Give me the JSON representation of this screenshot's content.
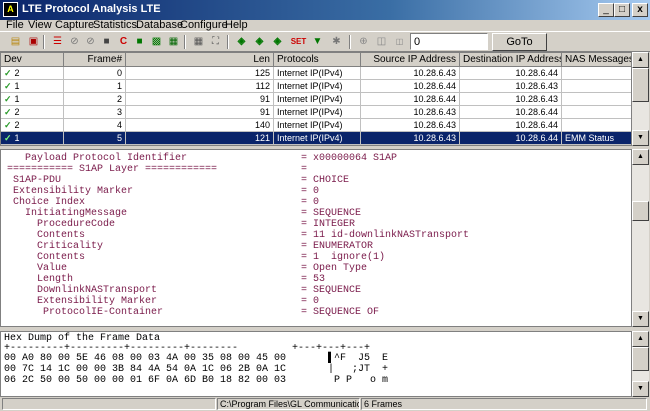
{
  "window": {
    "title": "LTE Protocol Analysis LTE",
    "icon_text": "A",
    "controls": [
      "_",
      "□",
      "x"
    ]
  },
  "menu": [
    "File",
    "View",
    "Capture",
    "Statistics",
    "Database",
    "Configure",
    "Help"
  ],
  "toolbar": {
    "goto_value": "0",
    "goto_label": "GoTo",
    "set_label": "SET"
  },
  "grid": {
    "columns": [
      "Dev",
      "Frame#",
      "Len",
      "Protocols",
      "Source IP Address",
      "Destination IP Address",
      "NAS Messages"
    ],
    "rows": [
      {
        "dev": "2",
        "frame": "0",
        "len": "125",
        "protocol": "Internet IP(IPv4)",
        "src": "10.28.6.43",
        "dst": "10.28.6.44",
        "nas": ""
      },
      {
        "dev": "1",
        "frame": "1",
        "len": "112",
        "protocol": "Internet IP(IPv4)",
        "src": "10.28.6.44",
        "dst": "10.28.6.43",
        "nas": ""
      },
      {
        "dev": "1",
        "frame": "2",
        "len": "91",
        "protocol": "Internet IP(IPv4)",
        "src": "10.28.6.44",
        "dst": "10.28.6.43",
        "nas": ""
      },
      {
        "dev": "2",
        "frame": "3",
        "len": "91",
        "protocol": "Internet IP(IPv4)",
        "src": "10.28.6.43",
        "dst": "10.28.6.44",
        "nas": ""
      },
      {
        "dev": "2",
        "frame": "4",
        "len": "140",
        "protocol": "Internet IP(IPv4)",
        "src": "10.28.6.43",
        "dst": "10.28.6.44",
        "nas": ""
      },
      {
        "dev": "1",
        "frame": "5",
        "len": "121",
        "protocol": "Internet IP(IPv4)",
        "src": "10.28.6.43",
        "dst": "10.28.6.44",
        "nas": "EMM Status"
      }
    ]
  },
  "decode": [
    {
      "name": "    Payload Protocol Identifier",
      "value": "= x00000064 S1AP"
    },
    {
      "name": " =========== S1AP Layer ============",
      "value": "="
    },
    {
      "name": "  S1AP-PDU",
      "value": "= CHOICE"
    },
    {
      "name": "  Extensibility Marker",
      "value": "= 0"
    },
    {
      "name": "  Choice Index",
      "value": "= 0"
    },
    {
      "name": "    InitiatingMessage",
      "value": "= SEQUENCE"
    },
    {
      "name": "      ProcedureCode",
      "value": "= INTEGER"
    },
    {
      "name": "      Contents",
      "value": "= 11 id-downlinkNASTransport"
    },
    {
      "name": "      Criticality",
      "value": "= ENUMERATOR"
    },
    {
      "name": "      Contents",
      "value": "= 1  ignore(1)"
    },
    {
      "name": "      Value",
      "value": "= Open Type"
    },
    {
      "name": "      Length",
      "value": "= 53"
    },
    {
      "name": "      DownlinkNASTransport",
      "value": "= SEQUENCE"
    },
    {
      "name": "      Extensibility Marker",
      "value": "= 0"
    },
    {
      "name": "       ProtocolIE-Container",
      "value": "= SEQUENCE OF"
    }
  ],
  "hex": [
    "Hex Dump of the Frame Data",
    "+---------+---------+---------+--------         +---+---+---+",
    "00 A0 80 00 5E 46 08 00 03 4A 00 35 08 00 45 00       ▌^F  J5  E",
    "00 7C 14 1C 00 00 3B 84 4A 54 0A 1C 06 2B 0A 1C       |   ;JT  +",
    "06 2C 50 00 50 00 00 01 6F 0A 6D B0 18 82 00 03        P P   o m"
  ],
  "status": {
    "path": "C:\\Program Files\\GL Communications I",
    "frames": "6 Frames"
  }
}
